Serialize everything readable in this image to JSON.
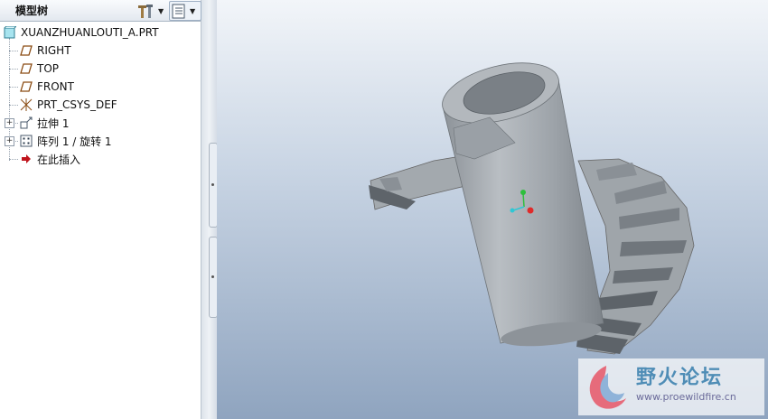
{
  "model_tree": {
    "title": "模型树",
    "items": [
      {
        "label": "XUANZHUANLOUTI_A.PRT",
        "icon": "part-icon"
      },
      {
        "label": "RIGHT",
        "icon": "datum-plane-icon"
      },
      {
        "label": "TOP",
        "icon": "datum-plane-icon"
      },
      {
        "label": "FRONT",
        "icon": "datum-plane-icon"
      },
      {
        "label": "PRT_CSYS_DEF",
        "icon": "coordinate-system-icon"
      },
      {
        "label": "拉伸 1",
        "icon": "extrude-icon"
      },
      {
        "label": "阵列 1 / 旋转 1",
        "icon": "pattern-icon"
      },
      {
        "label": "在此插入",
        "icon": "insert-here-arrow-icon"
      }
    ]
  },
  "toolbar": {
    "settings_icon": "tree-settings-icon",
    "show_icon": "tree-show-icon"
  },
  "watermark": {
    "brand": "野火论坛",
    "url": "www.proewildfire.cn"
  },
  "colors": {
    "part_gray": "#9aa0a6",
    "viewport_top": "#f2f5f9",
    "viewport_bottom": "#8fa4bf",
    "insert_arrow": "#c0141c"
  }
}
